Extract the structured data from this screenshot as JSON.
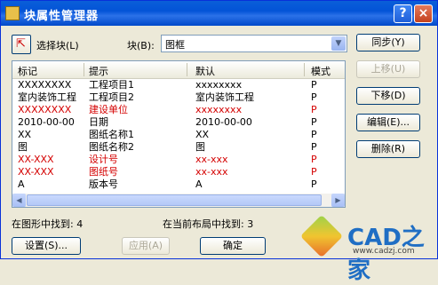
{
  "window": {
    "title": "块属性管理器",
    "help_label": "?",
    "close_label": "×"
  },
  "select_block": {
    "label": "选择块(L)",
    "block_label": "块(B):",
    "block_value": "图框"
  },
  "table": {
    "headers": [
      "标记",
      "提示",
      "默认",
      "模式"
    ],
    "rows": [
      {
        "tag": "XXXXXXXX",
        "prompt": "工程项目1",
        "default": "xxxxxxxx",
        "mode": "P",
        "red": false
      },
      {
        "tag": "室内装饰工程",
        "prompt": "工程项目2",
        "default": "室内装饰工程",
        "mode": "P",
        "red": false
      },
      {
        "tag": "XXXXXXXX",
        "prompt": "建设单位",
        "default": "xxxxxxxx",
        "mode": "P",
        "red": true
      },
      {
        "tag": "2010-00-00",
        "prompt": "日期",
        "default": "2010-00-00",
        "mode": "P",
        "red": false
      },
      {
        "tag": "XX",
        "prompt": "图纸名称1",
        "default": "XX",
        "mode": "P",
        "red": false
      },
      {
        "tag": "图",
        "prompt": "图纸名称2",
        "default": "图",
        "mode": "P",
        "red": false
      },
      {
        "tag": "XX-XXX",
        "prompt": "设计号",
        "default": "xx-xxx",
        "mode": "P",
        "red": true
      },
      {
        "tag": "XX-XXX",
        "prompt": "图纸号",
        "default": "xx-xxx",
        "mode": "P",
        "red": true
      },
      {
        "tag": "A",
        "prompt": "版本号",
        "default": "A",
        "mode": "P",
        "red": false
      }
    ]
  },
  "side_buttons": {
    "sync": "同步(Y)",
    "move_up": "上移(U)",
    "move_down": "下移(D)",
    "edit": "编辑(E)...",
    "delete": "删除(R)"
  },
  "status": {
    "found_in_drawing": "在图形中找到: 4",
    "found_in_layout": "在当前布局中找到: 3"
  },
  "bottom_buttons": {
    "settings": "设置(S)...",
    "apply": "应用(A)",
    "ok": "确定"
  },
  "watermark": {
    "brand": "CAD之家",
    "url": "www.cadzj.com"
  }
}
